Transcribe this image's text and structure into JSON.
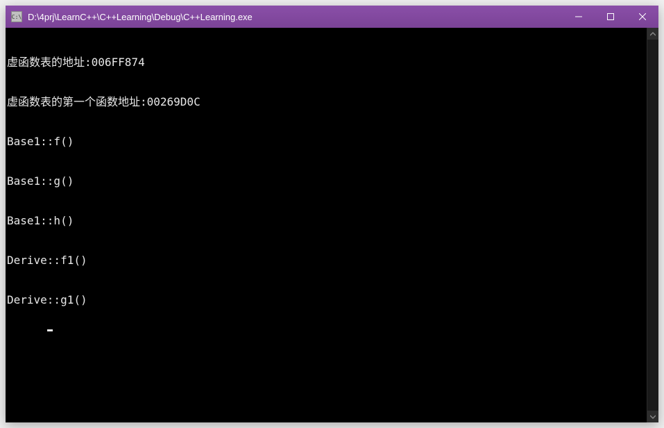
{
  "window": {
    "title": "D:\\4prj\\LearnC++\\C++Learning\\Debug\\C++Learning.exe",
    "icon_label": "C:\\"
  },
  "console": {
    "lines": [
      "虚函数表的地址:006FF874",
      "虚函数表的第一个函数地址:00269D0C",
      "Base1::f()",
      "Base1::g()",
      "Base1::h()",
      "Derive::f1()",
      "Derive::g1()"
    ]
  },
  "colors": {
    "titlebar": "#7b4397",
    "console_bg": "#000000",
    "console_fg": "#e8e8e8"
  }
}
